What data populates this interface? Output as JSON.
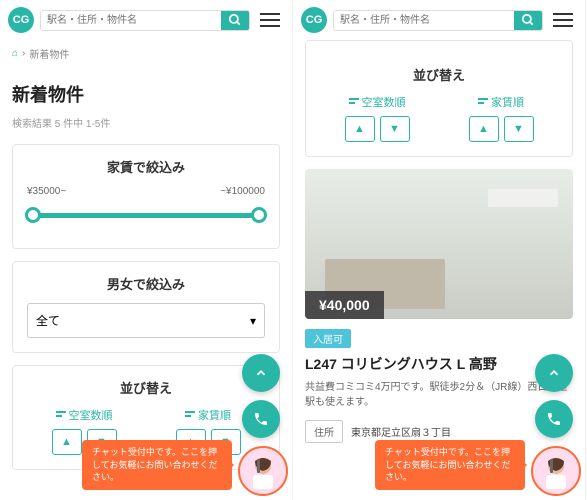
{
  "search_placeholder": "駅名・住所・物件名",
  "breadcrumb": {
    "home": "⌂",
    "sep": "›",
    "current": "新着物件"
  },
  "page_title": "新着物件",
  "result_count": "検索結果 5 件中 1-5件",
  "filters": {
    "rent": {
      "title": "家賃で絞込み",
      "min": "¥35000~",
      "max": "~¥100000"
    },
    "gender": {
      "title": "男女で絞込み",
      "selected": "全て"
    }
  },
  "sort": {
    "title": "並び替え",
    "cols": [
      {
        "label": "空室数順"
      },
      {
        "label": "家賃順"
      }
    ]
  },
  "chat_text": "チャット受付中です。ここを押してお気軽にお問い合わせください。",
  "listing": {
    "price": "¥40,000",
    "status": "入居可",
    "title": "L247 コリビングハウス L 高野",
    "desc": "共益費コミコミ4万円です。駅徒歩2分＆（JR線）西日暮里駅も使えます。",
    "addr_label": "住所",
    "addr_value": "東京都足立区扇３丁目"
  }
}
